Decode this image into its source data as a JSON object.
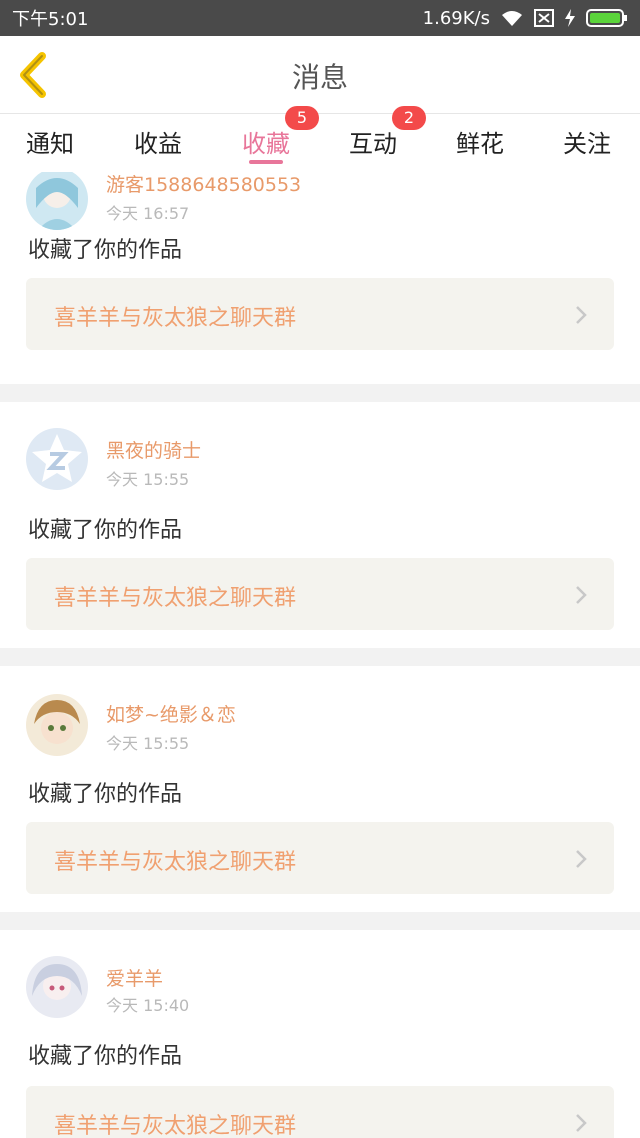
{
  "status_bar": {
    "time": "下午5:01",
    "speed": "1.69K/s",
    "icons": [
      "wifi-icon",
      "sim-x-icon",
      "charging-icon",
      "battery-icon"
    ]
  },
  "header": {
    "title": "消息",
    "back_icon": "chevron-left-icon"
  },
  "tabs": [
    {
      "label": "通知"
    },
    {
      "label": "收益"
    },
    {
      "label": "收藏",
      "badge": "5",
      "active": true
    },
    {
      "label": "互动",
      "badge": "2"
    },
    {
      "label": "鲜花"
    },
    {
      "label": "关注"
    }
  ],
  "items": [
    {
      "username": "游客1588648580553",
      "time": "今天 16:57",
      "action": "收藏了你的作品",
      "work": "喜羊羊与灰太狼之聊天群",
      "avatar": "anime-girl-blue-avatar"
    },
    {
      "username": "黑夜的骑士",
      "time": "今天 15:55",
      "action": "收藏了你的作品",
      "work": "喜羊羊与灰太狼之聊天群",
      "avatar": "default-star-avatar"
    },
    {
      "username": "如梦~绝影＆恋",
      "time": "今天 15:55",
      "action": "收藏了你的作品",
      "work": "喜羊羊与灰太狼之聊天群",
      "avatar": "anime-boy-avatar"
    },
    {
      "username": "爱羊羊",
      "time": "今天 15:40",
      "action": "收藏了你的作品",
      "work": "喜羊羊与灰太狼之聊天群",
      "avatar": "anime-girl-white-avatar"
    }
  ],
  "colors": {
    "accent_pink": "#e8769a",
    "name_orange": "#e89a6a",
    "work_orange": "#f0a070",
    "back_yellow": "#f5c400",
    "badge_red": "#f34a4a"
  }
}
